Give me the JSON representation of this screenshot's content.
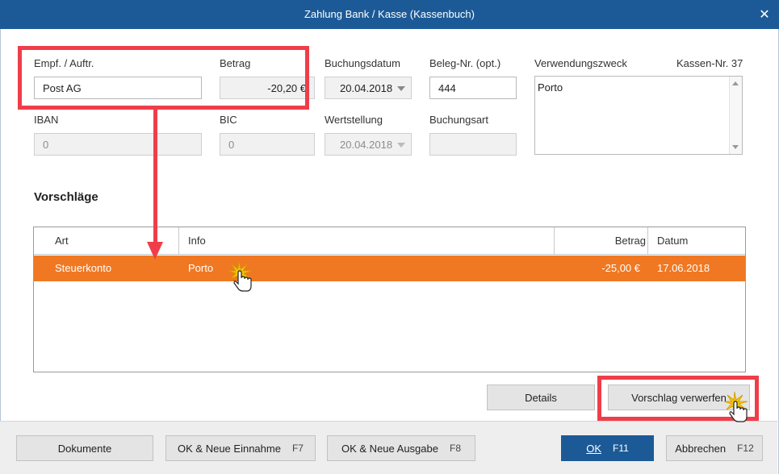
{
  "window": {
    "title": "Zahlung Bank / Kasse (Kassenbuch)",
    "close_glyph": "✕"
  },
  "form": {
    "recipient_label": "Empf. / Auftr.",
    "recipient_value": "Post AG",
    "amount_label": "Betrag",
    "amount_value": "-20,20 €",
    "booking_date_label": "Buchungsdatum",
    "booking_date_value": "20.04.2018",
    "receipt_no_label": "Beleg-Nr. (opt.)",
    "receipt_no_value": "444",
    "purpose_label": "Verwendungszweck",
    "purpose_value": "Porto",
    "cash_no_label": "Kassen-Nr. 37",
    "iban_label": "IBAN",
    "iban_value": "0",
    "bic_label": "BIC",
    "bic_value": "0",
    "value_date_label": "Wertstellung",
    "value_date_value": "20.04.2018",
    "booking_type_label": "Buchungsart",
    "booking_type_value": ""
  },
  "suggestions": {
    "title": "Vorschläge",
    "columns": [
      "Art",
      "Info",
      "Betrag",
      "Datum"
    ],
    "rows": [
      {
        "art": "Steuerkonto",
        "info": "Porto",
        "betrag": "-25,00 €",
        "datum": "17.06.2018"
      }
    ]
  },
  "actions": {
    "details": "Details",
    "discard_suggestion": "Vorschlag verwerfen"
  },
  "footer": {
    "documents": "Dokumente",
    "ok_new_income": "OK & Neue Einnahme",
    "ok_new_income_key": "F7",
    "ok_new_expense": "OK & Neue Ausgabe",
    "ok_new_expense_key": "F8",
    "ok": "OK",
    "ok_key": "F11",
    "cancel": "Abbrechen",
    "cancel_key": "F12"
  },
  "colors": {
    "titlebar": "#1c5a97",
    "selected_row": "#f07822",
    "highlight": "#ef3e4a",
    "primary_button": "#1c5a97"
  }
}
